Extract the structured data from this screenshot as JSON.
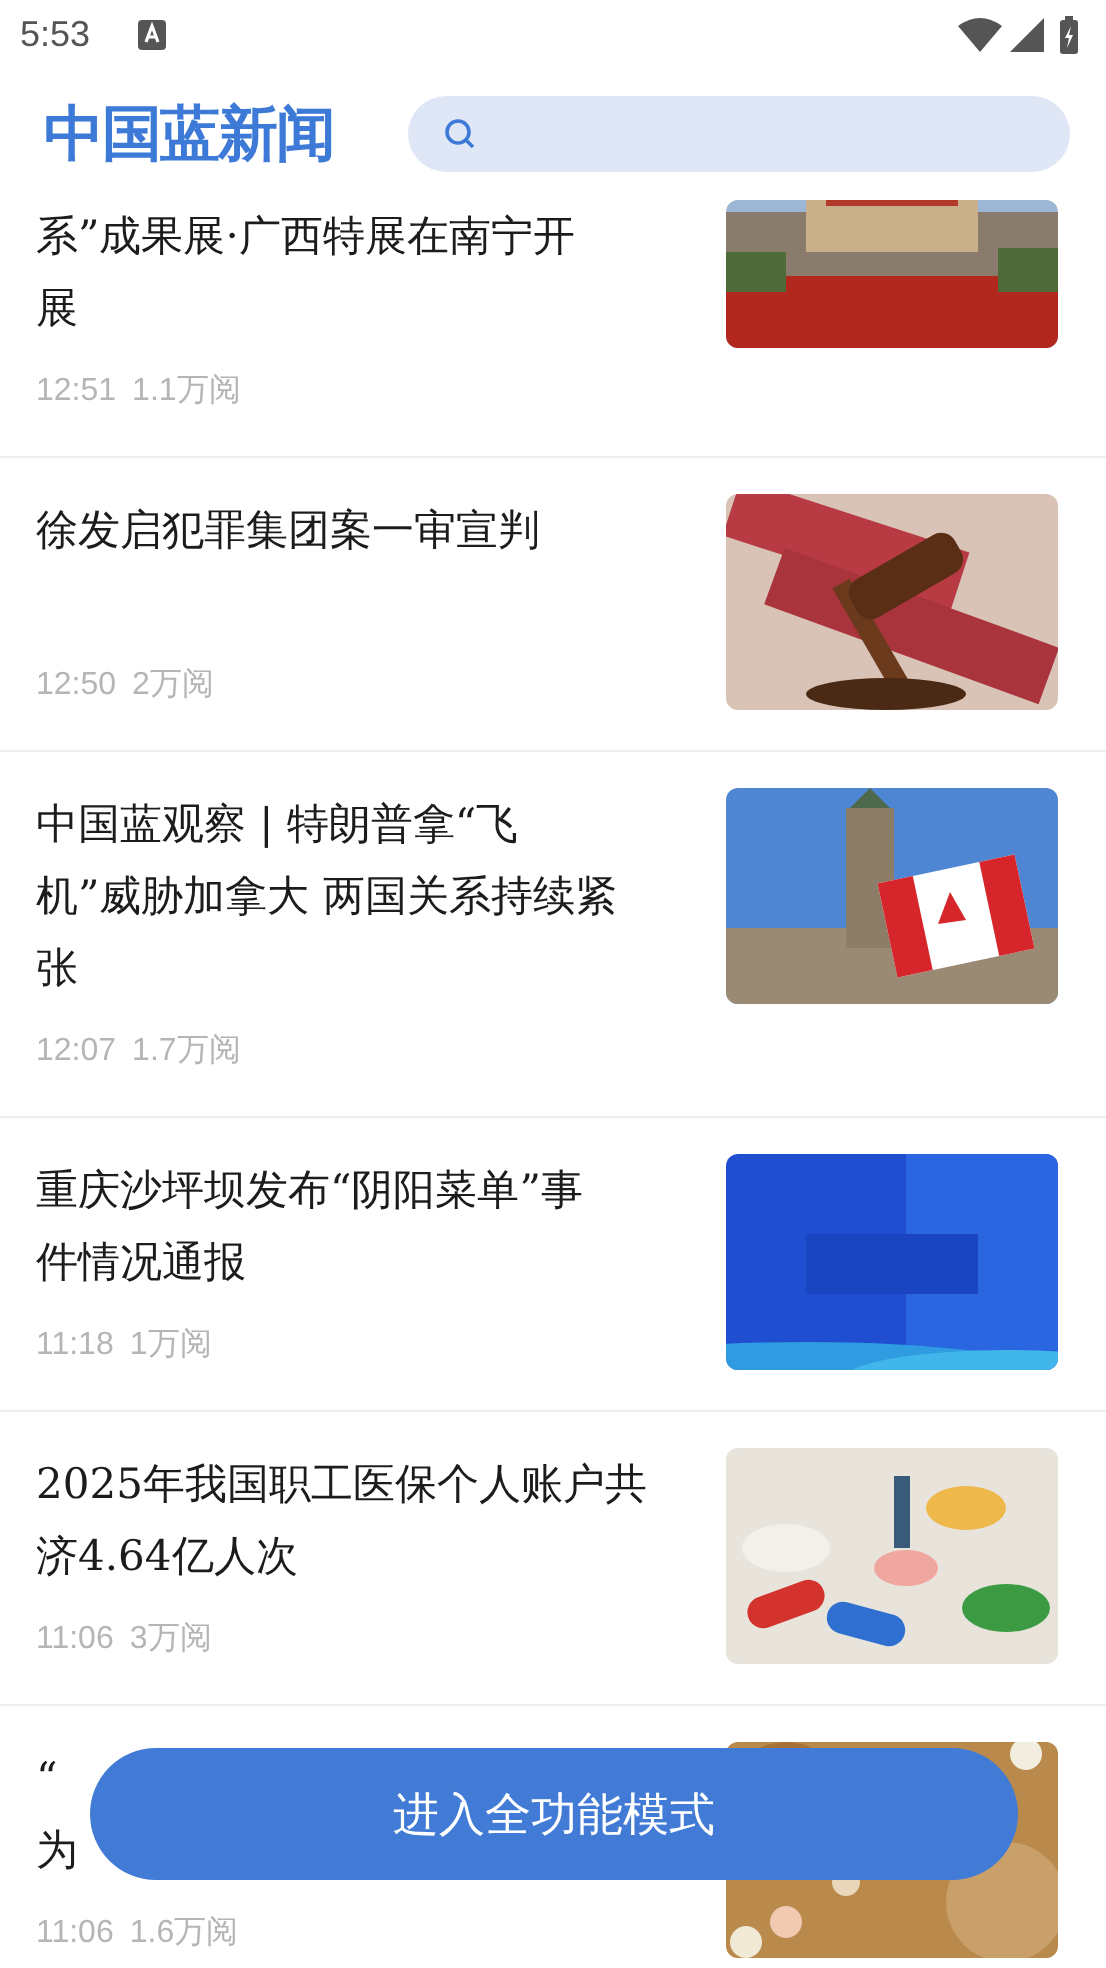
{
  "status_bar": {
    "time": "5:53"
  },
  "header": {
    "logo": "中国蓝新闻"
  },
  "articles": [
    {
      "title_lines": [
        "系”成果展·广西特展在南宁开",
        "展"
      ],
      "time": "12:51",
      "views": "1.1万阅"
    },
    {
      "title_lines": [
        "徐发启犯罪集团案一审宣判"
      ],
      "time": "12:50",
      "views": "2万阅"
    },
    {
      "title_lines": [
        "中国蓝观察 | 特朗普拿“飞",
        "机”威胁加拿大 两国关系持续紧",
        "张"
      ],
      "time": "12:07",
      "views": "1.7万阅"
    },
    {
      "title_lines": [
        "重庆沙坪坝发布“阴阳菜单”事",
        "件情况通报"
      ],
      "time": "11:18",
      "views": "1万阅"
    },
    {
      "title_lines": [
        "2025年我国职工医保个人账户共",
        "济4.64亿人次"
      ],
      "time": "11:06",
      "views": "3万阅"
    },
    {
      "title_lines": [
        "“",
        "为"
      ],
      "time": "11:06",
      "views": "1.6万阅"
    }
  ],
  "full_mode_button": {
    "label": "进入全功能模式"
  }
}
